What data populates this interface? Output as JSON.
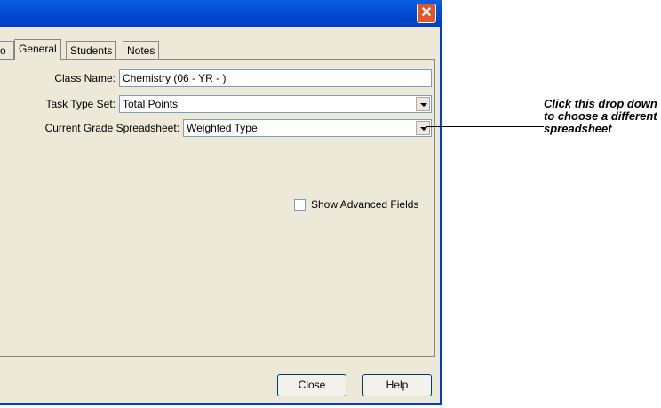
{
  "window": {
    "close_glyph": "✕"
  },
  "tabs": [
    {
      "label": "General",
      "active": true
    },
    {
      "label": "Students",
      "active": false
    },
    {
      "label": "Notes",
      "active": false
    }
  ],
  "tab_cut_label": "o",
  "form": {
    "class_name_label": "Class Name:",
    "class_name_value": "Chemistry (06 - YR - )",
    "task_type_label": "Task Type Set:",
    "task_type_value": "Total Points",
    "grade_sheet_label": "Current Grade Spreadsheet:",
    "grade_sheet_value": "Weighted Type",
    "advanced_label": "Show Advanced Fields",
    "advanced_checked": false
  },
  "buttons": {
    "close": "Close",
    "help": "Help"
  },
  "callout": {
    "text": "Click this drop down to choose a different spreadsheet"
  }
}
